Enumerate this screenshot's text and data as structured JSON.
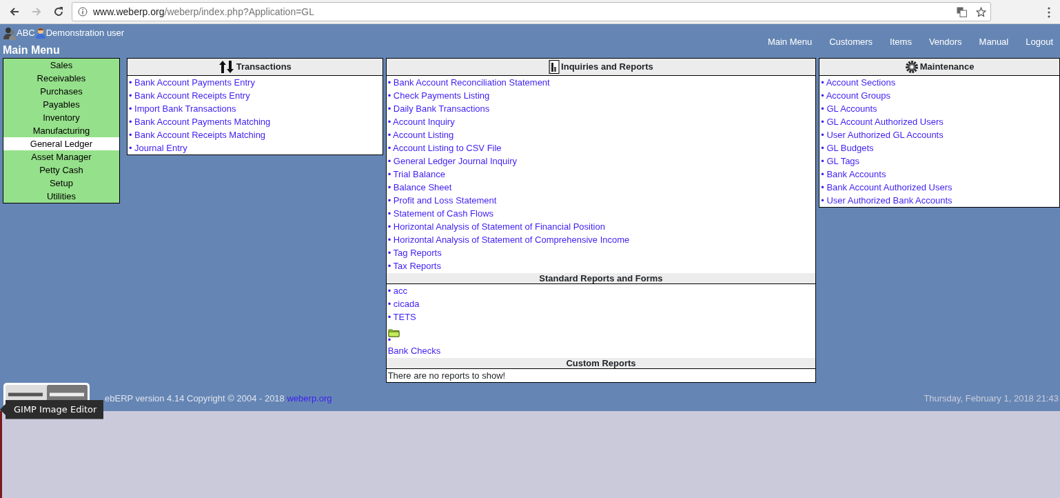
{
  "browser": {
    "url_host": "www.weberp.org",
    "url_path": "/weberp/index.php?Application=GL"
  },
  "header": {
    "company": "ABC",
    "user": "Demonstration user",
    "title": "Main Menu"
  },
  "top_nav": [
    "Main Menu",
    "Customers",
    "Items",
    "Vendors",
    "Manual",
    "Logout"
  ],
  "modules": [
    {
      "label": "Sales",
      "selected": false
    },
    {
      "label": "Receivables",
      "selected": false
    },
    {
      "label": "Purchases",
      "selected": false
    },
    {
      "label": "Payables",
      "selected": false
    },
    {
      "label": "Inventory",
      "selected": false
    },
    {
      "label": "Manufacturing",
      "selected": false
    },
    {
      "label": "General Ledger",
      "selected": true
    },
    {
      "label": "Asset Manager",
      "selected": false
    },
    {
      "label": "Petty Cash",
      "selected": false
    },
    {
      "label": "Setup",
      "selected": false
    },
    {
      "label": "Utilities",
      "selected": false
    }
  ],
  "transactions": {
    "title": "Transactions",
    "items": [
      "• Bank Account Payments Entry",
      "• Bank Account Receipts Entry",
      "• Import Bank Transactions",
      "• Bank Account Payments Matching",
      "• Bank Account Receipts Matching",
      "• Journal Entry"
    ]
  },
  "inquiries": {
    "title": "Inquiries and Reports",
    "items": [
      "• Bank Account Reconciliation Statement",
      "• Check Payments Listing",
      "• Daily Bank Transactions",
      "• Account Inquiry",
      "• Account Listing",
      "• Account Listing to CSV File",
      "• General Ledger Journal Inquiry",
      "• Trial Balance",
      "• Balance Sheet",
      "• Profit and Loss Statement",
      "• Statement of Cash Flows",
      "• Horizontal Analysis of Statement of Financial Position",
      "• Horizontal Analysis of Statement of Comprehensive Income",
      "• Tag Reports",
      "• Tax Reports"
    ],
    "standard_title": "Standard Reports and Forms",
    "standard_items": [
      {
        "kind": "link",
        "text": "• acc"
      },
      {
        "kind": "link",
        "text": "• cicada"
      },
      {
        "kind": "link",
        "text": "• TETS"
      },
      {
        "kind": "folder"
      },
      {
        "kind": "bullet",
        "text": "•"
      },
      {
        "kind": "link",
        "text": "Bank Checks"
      }
    ],
    "custom_title": "Custom Reports",
    "custom_message": "There are no reports to show!"
  },
  "maintenance": {
    "title": "Maintenance",
    "items": [
      "• Account Sections",
      "• Account Groups",
      "• GL Accounts",
      "• GL Account Authorized Users",
      "• User Authorized GL Accounts",
      "• GL Budgets",
      "• GL Tags",
      "• Bank Accounts",
      "• Bank Account Authorized Users",
      "• User Authorized Bank Accounts"
    ]
  },
  "footer": {
    "copyright": "ebERP version 4.14 Copyright © 2004 - 2018",
    "link": "weberp.org",
    "datetime": "Thursday, February 1, 2018 21:43"
  },
  "tooltip": "GIMP Image Editor"
}
